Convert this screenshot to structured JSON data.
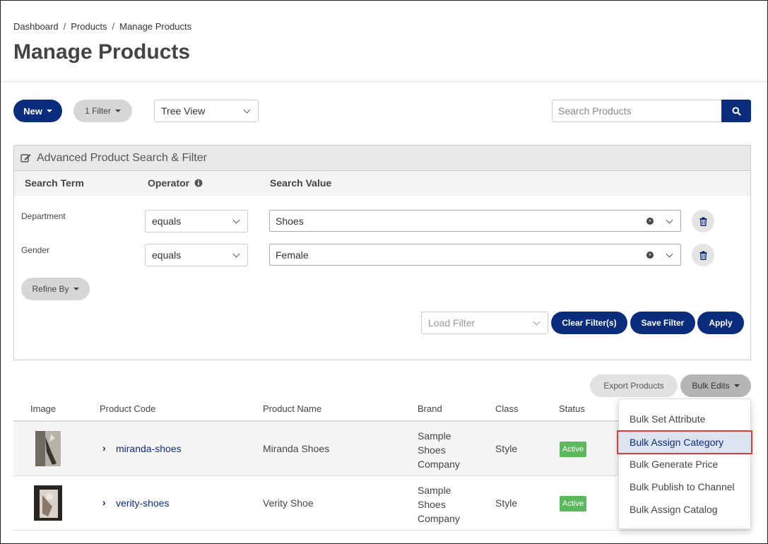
{
  "breadcrumb": [
    "Dashboard",
    "Products",
    "Manage Products"
  ],
  "page_title": "Manage Products",
  "toolbar": {
    "new_label": "New",
    "filter_label": "1 Filter",
    "view_select": "Tree View",
    "search_placeholder": "Search Products"
  },
  "panel": {
    "title": "Advanced Product Search & Filter",
    "columns": {
      "term": "Search Term",
      "operator": "Operator",
      "value": "Search Value"
    },
    "rows": [
      {
        "term": "Department",
        "operator": "equals",
        "value": "Shoes"
      },
      {
        "term": "Gender",
        "operator": "equals",
        "value": "Female"
      }
    ],
    "refine_label": "Refine By",
    "load_filter_placeholder": "Load Filter",
    "clear_label": "Clear Filter(s)",
    "save_label": "Save Filter",
    "apply_label": "Apply"
  },
  "actions": {
    "export_label": "Export Products",
    "bulk_label": "Bulk Edits"
  },
  "table": {
    "headers": [
      "Image",
      "Product Code",
      "Product Name",
      "Brand",
      "Class",
      "Status"
    ],
    "rows": [
      {
        "code": "miranda-shoes",
        "name": "Miranda Shoes",
        "brand": [
          "Sample",
          "Shoes",
          "Company"
        ],
        "class": "Style",
        "status": "Active"
      },
      {
        "code": "verity-shoes",
        "name": "Verity Shoe",
        "brand": [
          "Sample",
          "Shoes",
          "Company"
        ],
        "class": "Style",
        "status": "Active"
      }
    ]
  },
  "bulk_menu": [
    "Bulk Set Attribute",
    "Bulk Assign Category",
    "Bulk Generate Price",
    "Bulk Publish to Channel",
    "Bulk Assign Catalog"
  ],
  "bulk_menu_highlighted": "Bulk Assign Category",
  "colors": {
    "primary": "#0b2b7d",
    "active_badge": "#5cb85c",
    "highlight_border": "#e03c3c"
  }
}
